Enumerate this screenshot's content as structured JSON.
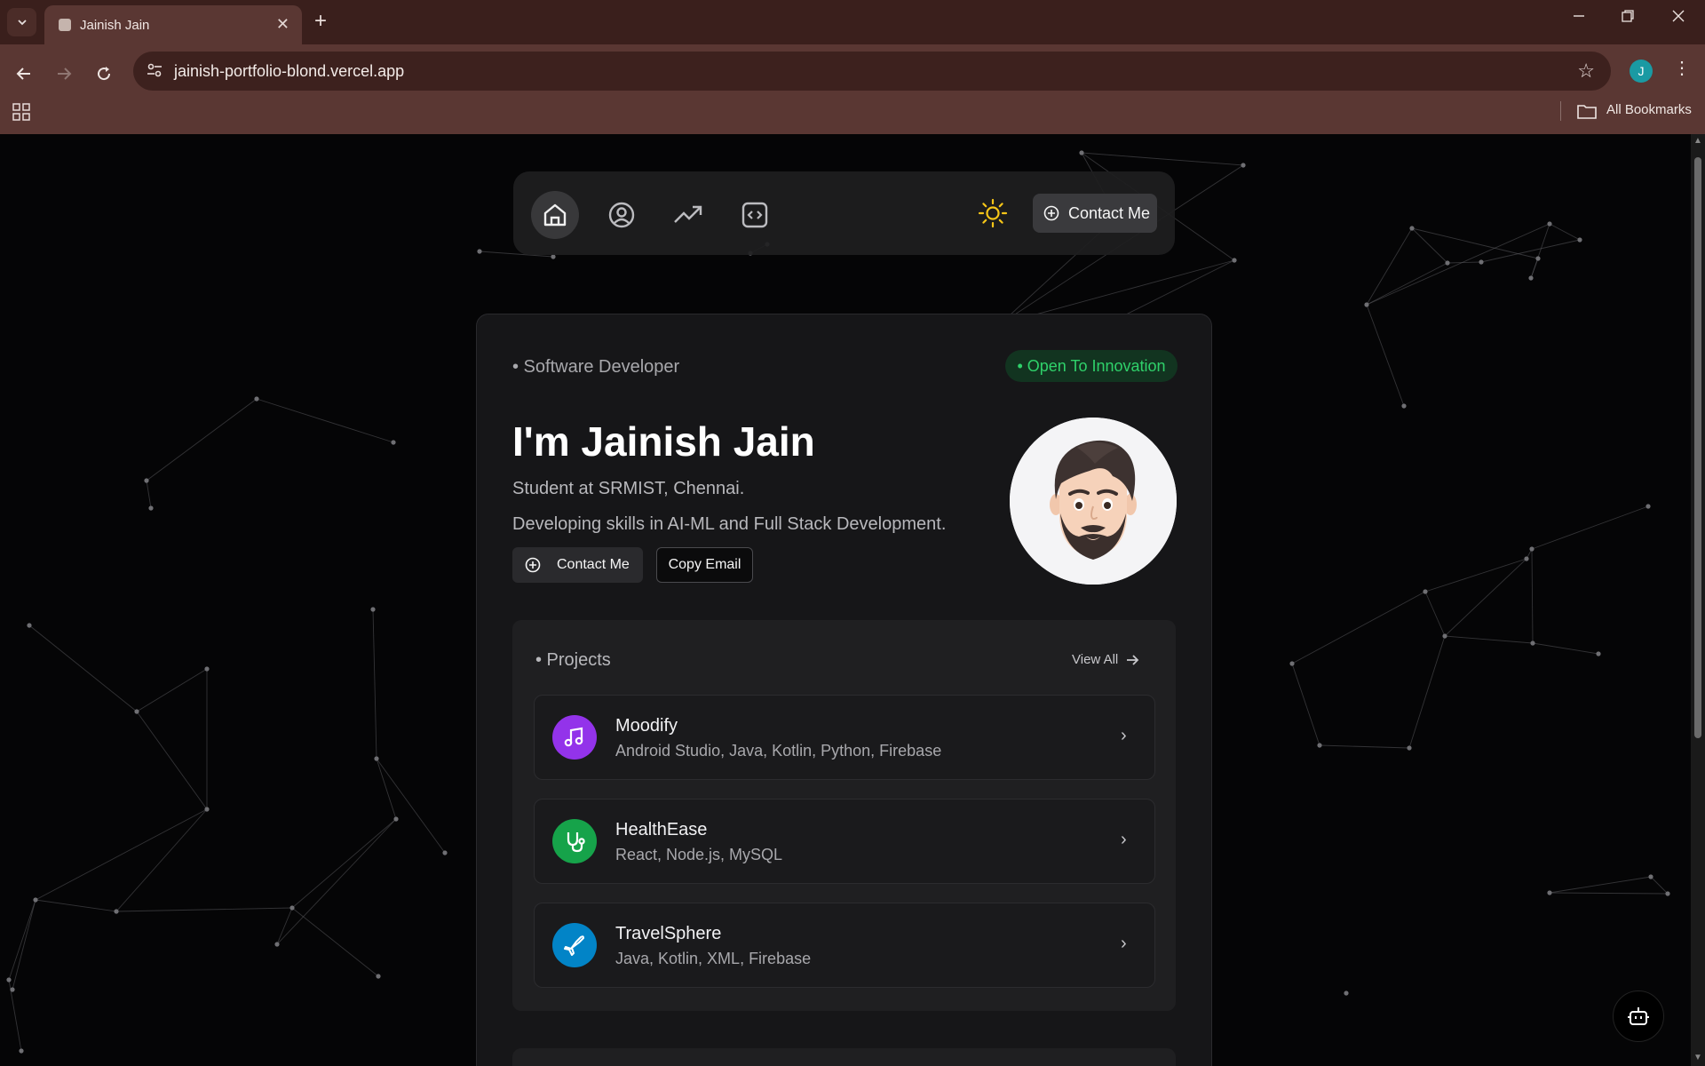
{
  "browser": {
    "tab_title": "Jainish Jain",
    "url": "jainish-portfolio-blond.vercel.app",
    "profile_initial": "J",
    "bookmarks_label": "All Bookmarks",
    "accent_color": "#5a3733"
  },
  "nav": {
    "items": [
      {
        "name": "home",
        "icon": "home-icon",
        "active": true
      },
      {
        "name": "about",
        "icon": "user-circle-icon",
        "active": false
      },
      {
        "name": "experience",
        "icon": "trending-up-icon",
        "active": false
      },
      {
        "name": "projects",
        "icon": "code-square-icon",
        "active": false
      }
    ],
    "theme_icon": "sun-icon",
    "contact_label": "Contact Me"
  },
  "hero": {
    "role": "• Software Developer",
    "status": "• Open To Innovation",
    "status_color": "#2fd16a",
    "headline": "I'm Jainish Jain",
    "subtitle1": "Student at SRMIST, Chennai.",
    "subtitle2": "Developing skills in AI-ML and Full Stack Development.",
    "contact_button": "Contact Me",
    "copy_button": "Copy Email",
    "avatar_icon": "memoji-avatar"
  },
  "projects": {
    "heading": "• Projects",
    "view_all": "View All",
    "items": [
      {
        "name": "Moodify",
        "tech": "Android Studio, Java, Kotlin, Python, Firebase",
        "icon": "music-note-icon",
        "color": "#9333ea"
      },
      {
        "name": "HealthEase",
        "tech": "React, Node.js, MySQL",
        "icon": "stethoscope-icon",
        "color": "#16a34a"
      },
      {
        "name": "TravelSphere",
        "tech": "Java, Kotlin, XML, Firebase",
        "icon": "plane-icon",
        "color": "#0284c7"
      }
    ]
  },
  "chatbot_icon": "bot-icon"
}
